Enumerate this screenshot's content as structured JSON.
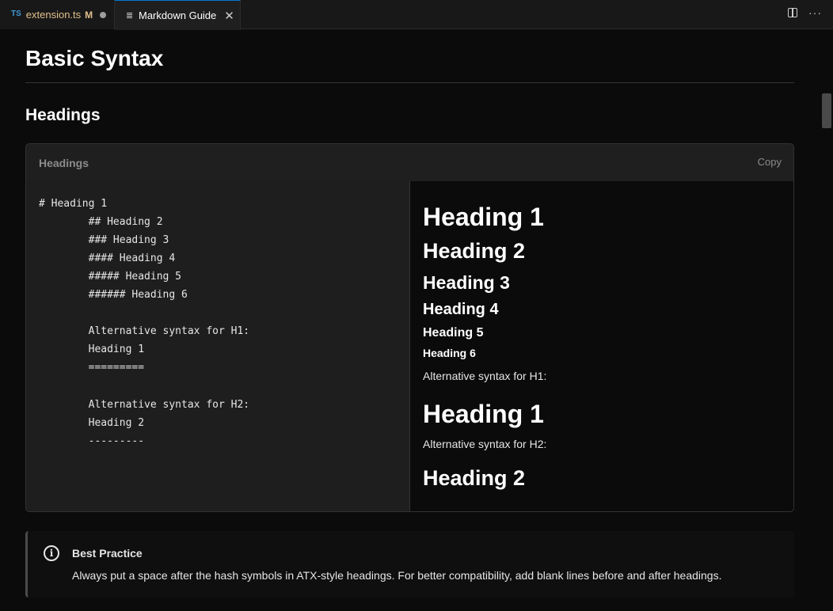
{
  "tabs": [
    {
      "icon": "TS",
      "label": "extension.ts",
      "status": "M"
    },
    {
      "icon": "markdown-preview-icon",
      "label": "Markdown Guide",
      "close": "✕"
    }
  ],
  "page": {
    "title": "Basic Syntax",
    "section_title": "Headings"
  },
  "example": {
    "title": "Headings",
    "copy_label": "Copy",
    "code_lines": [
      "# Heading 1",
      "        ## Heading 2",
      "        ### Heading 3",
      "        #### Heading 4",
      "        ##### Heading 5",
      "        ###### Heading 6",
      "",
      "        Alternative syntax for H1:",
      "        Heading 1",
      "        =========",
      "",
      "        Alternative syntax for H2:",
      "        Heading 2",
      "        ---------"
    ],
    "preview": {
      "h1": "Heading 1",
      "h2": "Heading 2",
      "h3": "Heading 3",
      "h4": "Heading 4",
      "h5": "Heading 5",
      "h6": "Heading 6",
      "alt_h1_label": "Alternative syntax for H1:",
      "alt_h1": "Heading 1",
      "alt_h2_label": "Alternative syntax for H2:",
      "alt_h2": "Heading 2"
    }
  },
  "callout": {
    "icon": "i",
    "title": "Best Practice",
    "body": "Always put a space after the hash symbols in ATX-style headings. For better compatibility, add blank lines before and after headings."
  }
}
